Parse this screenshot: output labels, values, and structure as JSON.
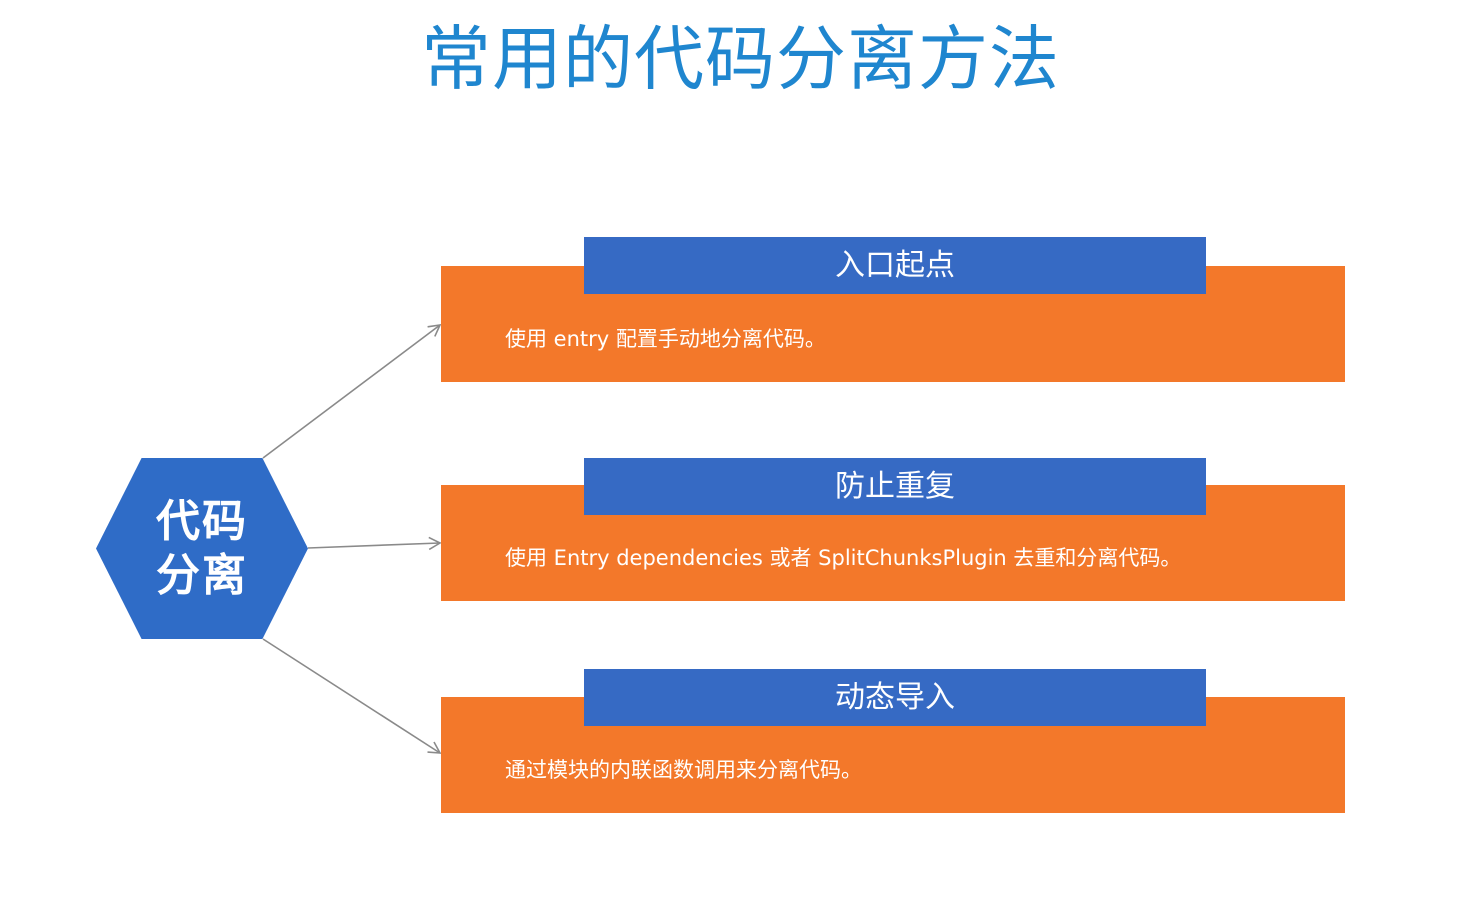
{
  "title": "常用的代码分离方法",
  "center_node": {
    "line1": "代码",
    "line2": "分离",
    "color": "#2f6cc7"
  },
  "branches": [
    {
      "title": "入口起点",
      "description": "使用 entry 配置手动地分离代码。"
    },
    {
      "title": "防止重复",
      "description": "使用 Entry dependencies 或者 SplitChunksPlugin 去重和分离代码。"
    },
    {
      "title": "动态导入",
      "description": "通过模块的内联函数调用来分离代码。"
    }
  ],
  "colors": {
    "title": "#1f86cf",
    "header": "#366ac4",
    "card": "#f3782a",
    "connector": "#8a8a8a"
  }
}
